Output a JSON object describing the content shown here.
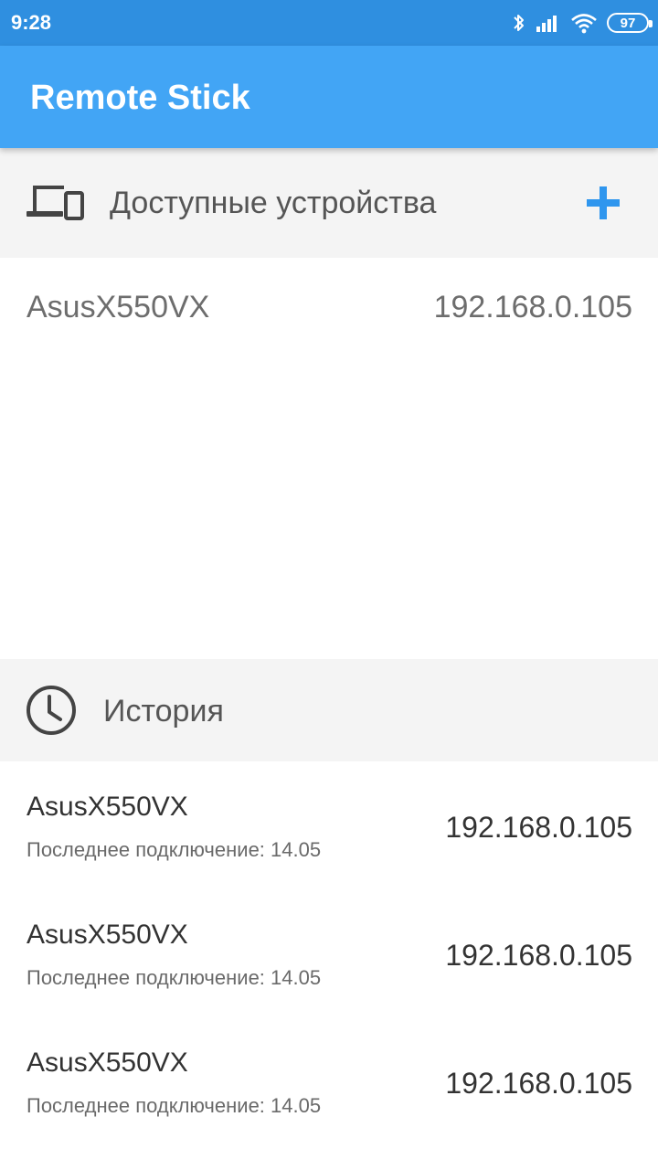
{
  "status_bar": {
    "time": "9:28",
    "battery": "97",
    "icons": [
      "bluetooth-icon",
      "signal-icon",
      "wifi-icon",
      "battery-icon"
    ]
  },
  "app_bar": {
    "title": "Remote Stick",
    "color": "#42a5f5"
  },
  "devices_section": {
    "title": "Доступные устройства",
    "icon": "devices-icon",
    "add_icon": "plus-icon",
    "items": [
      {
        "name": "AsusX550VX",
        "ip": "192.168.0.105"
      }
    ]
  },
  "history_section": {
    "title": "История",
    "icon": "clock-icon",
    "items": [
      {
        "name": "AsusX550VX",
        "last_connection": "Последнее подключение: 14.05",
        "ip": "192.168.0.105"
      },
      {
        "name": "AsusX550VX",
        "last_connection": "Последнее подключение: 14.05",
        "ip": "192.168.0.105"
      },
      {
        "name": "AsusX550VX",
        "last_connection": "Последнее подключение: 14.05",
        "ip": "192.168.0.105"
      }
    ]
  }
}
